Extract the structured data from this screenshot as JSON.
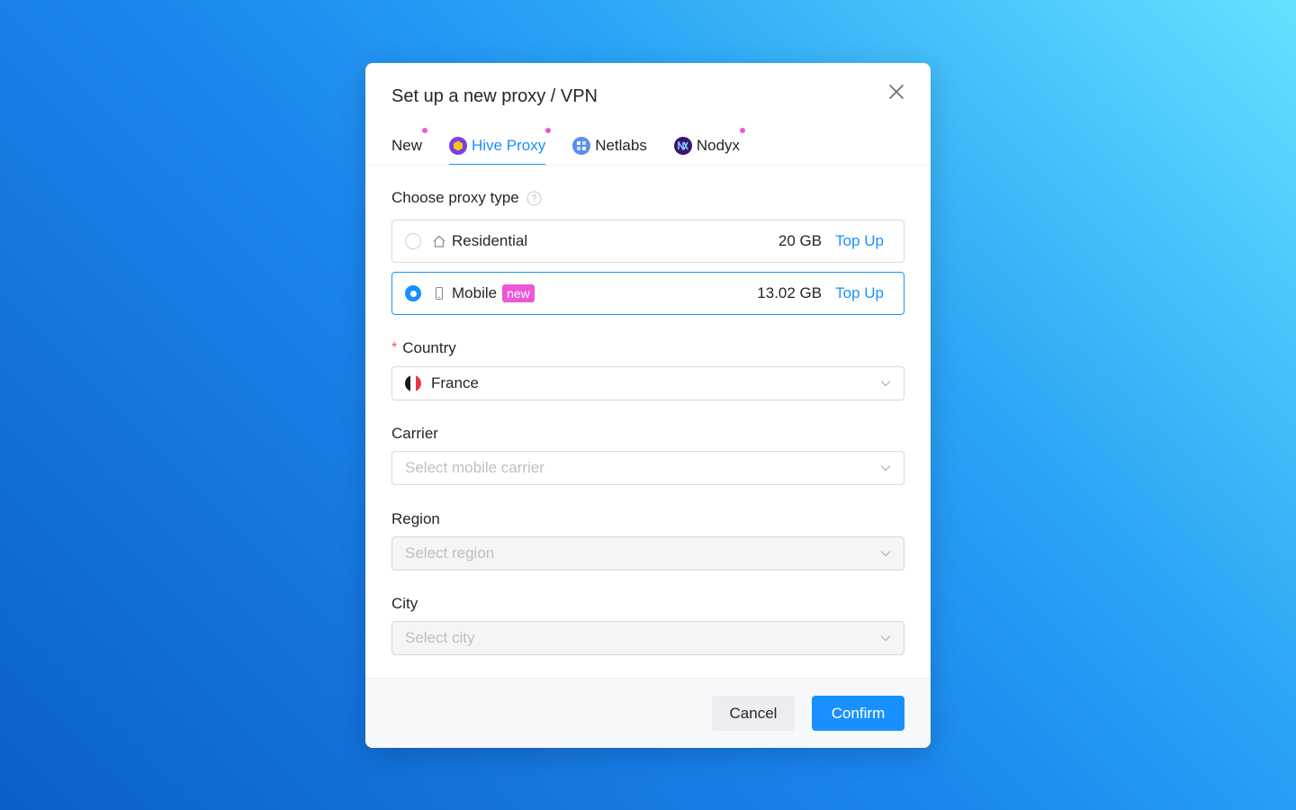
{
  "modal": {
    "title": "Set up a new proxy / VPN"
  },
  "tabs": [
    {
      "label": "New",
      "has_dot": true,
      "logo": "none"
    },
    {
      "label": "Hive Proxy",
      "has_dot": true,
      "logo": "hive-proxy-logo",
      "active": true
    },
    {
      "label": "Netlabs",
      "has_dot": false,
      "logo": "netlabs-logo"
    },
    {
      "label": "Nodyx",
      "has_dot": true,
      "logo": "nodyx-logo"
    }
  ],
  "proxy_type": {
    "label": "Choose proxy type",
    "help_icon": "question-circle-icon",
    "options": [
      {
        "label": "Residential",
        "icon": "home-icon",
        "amount": "20 GB",
        "action": "Top Up",
        "selected": false
      },
      {
        "label": "Mobile",
        "icon": "phone-icon",
        "badge": "new",
        "amount": "13.02 GB",
        "action": "Top Up",
        "selected": true
      }
    ]
  },
  "country": {
    "label": "Country",
    "required_mark": "*",
    "value": "France",
    "flag": "france-flag-icon"
  },
  "carrier": {
    "label": "Carrier",
    "placeholder": "Select mobile carrier"
  },
  "region": {
    "label": "Region",
    "placeholder": "Select region"
  },
  "city": {
    "label": "City",
    "placeholder": "Select city"
  },
  "footer": {
    "cancel_label": "Cancel",
    "confirm_label": "Confirm"
  },
  "colors": {
    "accent": "#1890ff",
    "badge": "#ee56d9",
    "required": "#ff4d4f"
  }
}
